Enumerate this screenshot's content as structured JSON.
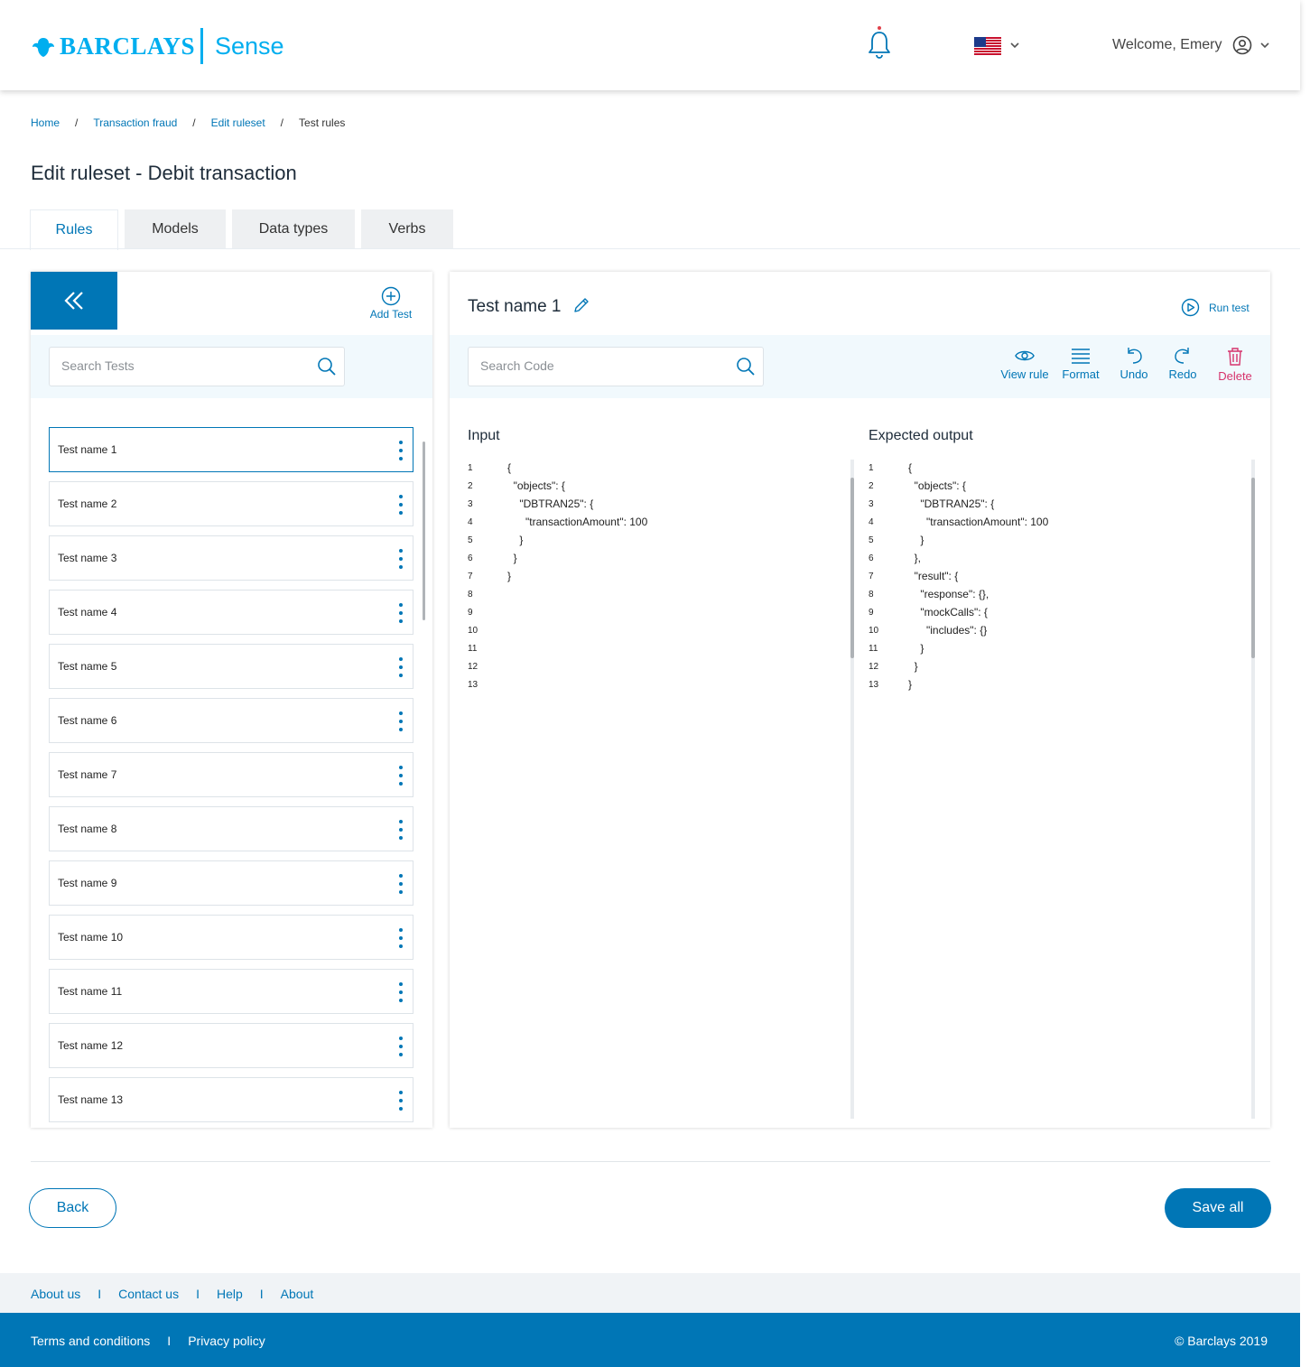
{
  "header": {
    "brand": "BARCLAYS",
    "product": "Sense",
    "welcome": "Welcome, Emery"
  },
  "breadcrumb": [
    "Home",
    "Transaction fraud",
    "Edit ruleset",
    "Test rules"
  ],
  "page_title": "Edit ruleset - Debit transaction",
  "tabs": [
    "Rules",
    "Models",
    "Data types",
    "Verbs"
  ],
  "left_panel": {
    "add_test": "Add Test",
    "search_placeholder": "Search Tests",
    "tests": [
      "Test name 1",
      "Test name 2",
      "Test name 3",
      "Test name 4",
      "Test name 5",
      "Test name 6",
      "Test name 7",
      "Test name 8",
      "Test name 9",
      "Test name 10",
      "Test name 11",
      "Test name 12",
      "Test name 13"
    ]
  },
  "right_panel": {
    "test_title": "Test name 1",
    "run_test": "Run test",
    "search_placeholder": "Search Code",
    "tools": {
      "view_rule": "View rule",
      "format": "Format",
      "undo": "Undo",
      "redo": "Redo",
      "delete": "Delete"
    },
    "input_label": "Input",
    "output_label": "Expected output",
    "input_lines": [
      {
        "n": "1",
        "t": "{"
      },
      {
        "n": "2",
        "t": "  \"objects\": {"
      },
      {
        "n": "3",
        "t": "    \"DBTRAN25\": {"
      },
      {
        "n": "4",
        "t": "      \"transactionAmount\": 100"
      },
      {
        "n": "5",
        "t": "    }"
      },
      {
        "n": "6",
        "t": "  }"
      },
      {
        "n": "7",
        "t": "}"
      },
      {
        "n": "8",
        "t": ""
      },
      {
        "n": "9",
        "t": ""
      },
      {
        "n": "10",
        "t": ""
      },
      {
        "n": "11",
        "t": ""
      },
      {
        "n": "12",
        "t": ""
      },
      {
        "n": "13",
        "t": ""
      }
    ],
    "output_lines": [
      {
        "n": "1",
        "t": "{"
      },
      {
        "n": "2",
        "t": "  \"objects\": {"
      },
      {
        "n": "3",
        "t": "    \"DBTRAN25\": {"
      },
      {
        "n": "4",
        "t": "      \"transactionAmount\": 100"
      },
      {
        "n": "5",
        "t": "    }"
      },
      {
        "n": "6",
        "t": "  },"
      },
      {
        "n": "7",
        "t": "  \"result\": {"
      },
      {
        "n": "8",
        "t": "    \"response\": {},"
      },
      {
        "n": "9",
        "t": "    \"mockCalls\": {"
      },
      {
        "n": "10",
        "t": "      \"includes\": {}"
      },
      {
        "n": "11",
        "t": "    }"
      },
      {
        "n": "12",
        "t": "  }"
      },
      {
        "n": "13",
        "t": "}"
      }
    ]
  },
  "actions": {
    "back": "Back",
    "save_all": "Save all"
  },
  "footer": {
    "top_links": [
      "About us",
      "Contact us",
      "Help",
      "About"
    ],
    "top_separator": "I",
    "bottom_links": [
      "Terms and conditions",
      "Privacy policy"
    ],
    "bottom_separator": "I",
    "copyright": "© Barclays 2019"
  },
  "colors": {
    "brand_blue": "#0076b6",
    "logo_cyan": "#00aeef",
    "delete_pink": "#d6336c"
  }
}
